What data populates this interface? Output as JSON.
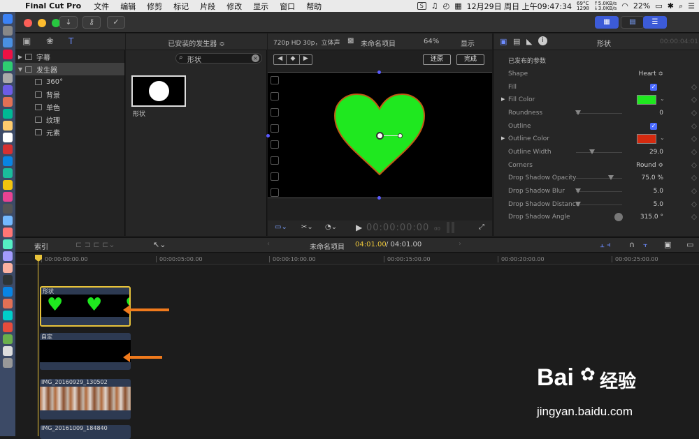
{
  "menubar": {
    "app": "Final Cut Pro",
    "items": [
      "文件",
      "编辑",
      "修剪",
      "标记",
      "片段",
      "修改",
      "显示",
      "窗口",
      "帮助"
    ],
    "temp": "69°C",
    "fan": "1298",
    "up": "↑5.0KB/s",
    "down": "↓3.0KB/s",
    "battery": "22%",
    "datetime": "12月29日 周日 上午09:47:34"
  },
  "library": {
    "items": [
      {
        "label": "字幕",
        "expanded": false
      },
      {
        "label": "发生器",
        "expanded": true
      },
      {
        "label": "360°"
      },
      {
        "label": "背景"
      },
      {
        "label": "单色"
      },
      {
        "label": "纹理"
      },
      {
        "label": "元素"
      }
    ]
  },
  "browser": {
    "header": "已安装的发生器 ≎",
    "search_value": "形状",
    "thumb_label": "形状"
  },
  "viewer": {
    "format": "720p HD 30p，立体声",
    "project": "未命名项目",
    "zoom": "64%",
    "display": "显示",
    "reset": "还原",
    "done": "完成",
    "timecode": "00:00:00:00",
    "frames": "00"
  },
  "inspector": {
    "title": "形状",
    "time": "00:00:04:01",
    "section": "已发布的参数",
    "params": [
      {
        "label": "Shape",
        "value": "Heart ≎"
      },
      {
        "label": "Fill",
        "checked": true
      },
      {
        "label": "Fill Color",
        "color": "#1fe81f"
      },
      {
        "label": "Roundness",
        "value": "0",
        "slider": 0.05
      },
      {
        "label": "Outline",
        "checked": true
      },
      {
        "label": "Outline Color",
        "color": "#d52a0f"
      },
      {
        "label": "Outline Width",
        "value": "29.0",
        "slider": 0.35
      },
      {
        "label": "Corners",
        "value": "Round ≎"
      },
      {
        "label": "Drop Shadow Opacity",
        "value": "75.0  %",
        "slider": 0.75
      },
      {
        "label": "Drop Shadow Blur",
        "value": "5.0",
        "slider": 0.05
      },
      {
        "label": "Drop Shadow Distance",
        "value": "5.0",
        "slider": 0.05
      },
      {
        "label": "Drop Shadow Angle",
        "value": "315.0  °"
      }
    ]
  },
  "timeline": {
    "index": "索引",
    "project": "未命名项目",
    "position": "04:01.00",
    "duration": "/ 04:01.00",
    "ruler": [
      "00:00:00:00.00",
      "00:00:05:00.00",
      "00:00:10:00.00",
      "00:00:15:00.00",
      "00:00:20:00.00",
      "00:00:25:00.00"
    ],
    "clips": [
      {
        "name": "形状"
      },
      {
        "name": "自定"
      },
      {
        "name": "IMG_20160929_130502"
      },
      {
        "name": "IMG_20161009_184840"
      }
    ]
  },
  "watermark": {
    "logo": "Bai",
    "logo2": "经验",
    "url": "jingyan.baidu.com"
  },
  "colors": {
    "accent": "#4b6bff",
    "heart": "#1fe81f",
    "outline": "#d52a0f",
    "arrow": "#f07a1c",
    "playhead": "#e8c33a"
  }
}
